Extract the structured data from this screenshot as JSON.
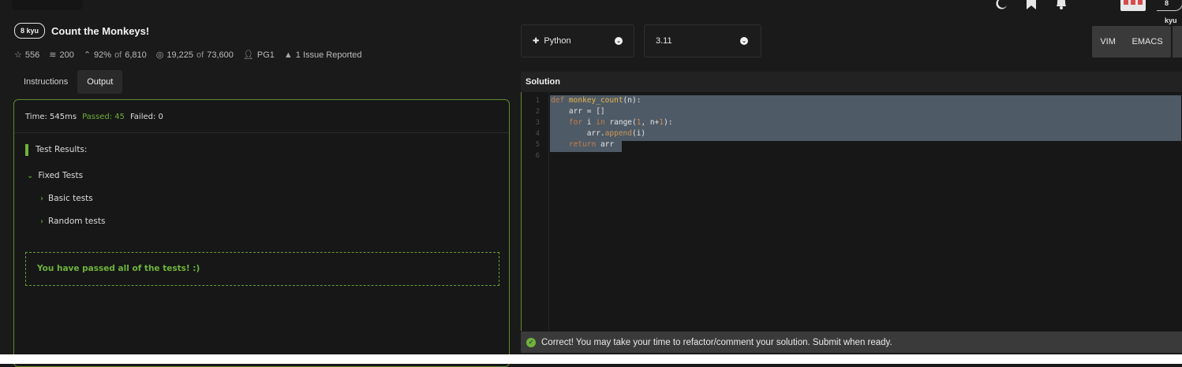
{
  "nav": {
    "icons": [
      "moon-icon",
      "bookmark-icon",
      "bell-icon"
    ],
    "avatar_rank": "8 kyu"
  },
  "kata": {
    "rank_badge": "8 kyu",
    "title": "Count the Monkeys!",
    "stats": {
      "stars": "556",
      "rank_points": "200",
      "satisfaction_pct": "92%",
      "satisfaction_of": "of",
      "satisfaction_total": "6,810",
      "completed": "19,225",
      "completed_of": "of",
      "attempted": "73,600",
      "author": "PG1",
      "issues": "1 Issue Reported"
    }
  },
  "tabs": [
    "Instructions",
    "Output"
  ],
  "active_tab": "Output",
  "output": {
    "time": "Time: 545ms",
    "passed": "Passed: 45",
    "failed": "Failed: 0",
    "results_heading": "Test Results:",
    "group": "Fixed Tests",
    "subgroups": [
      "Basic tests",
      "Random tests"
    ],
    "success_message": "You have passed all of the tests! :)"
  },
  "editor": {
    "language": "Python",
    "version": "3.11",
    "modes": [
      "VIM",
      "EMACS"
    ],
    "section_title": "Solution",
    "line_numbers": [
      "1",
      "2",
      "3",
      "4",
      "5",
      "6"
    ],
    "code": {
      "l1_kw": "def",
      "l1_fn": "monkey_count",
      "l1_rest": "(n):",
      "l2": "    arr = []",
      "l3_kw1": "for",
      "l3_var": " i ",
      "l3_kw2": "in",
      "l3_fn": " range(",
      "l3_n1": "1",
      "l3_mid": ", n+",
      "l3_n2": "1",
      "l3_end": "):",
      "l4_a": "arr.",
      "l4_fn": "append",
      "l4_b": "(i)",
      "l5_kw": "return",
      "l5_rest": " arr"
    },
    "status": "Correct! You may take your time to refactor/comment your solution. Submit when ready."
  },
  "colors": {
    "accent_green": "#6fb33c",
    "panel_border": "#5c8c2d",
    "selection": "#4e5a66"
  }
}
